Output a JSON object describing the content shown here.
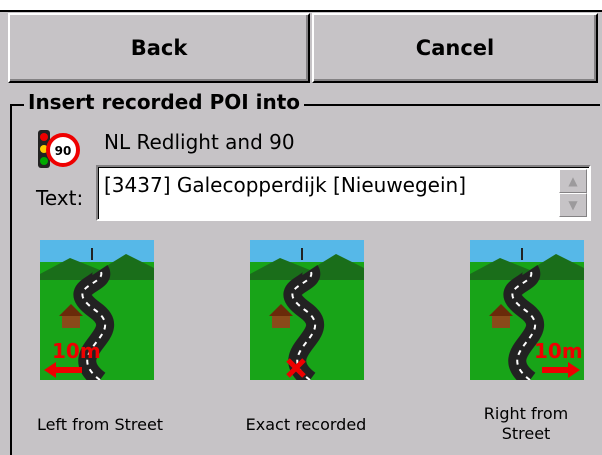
{
  "toolbar": {
    "back_label": "Back",
    "cancel_label": "Cancel"
  },
  "group": {
    "title": "Insert recorded POI into"
  },
  "poi": {
    "name": "NL Redlight and 90",
    "speed": "90"
  },
  "text_field": {
    "label": "Text:",
    "value": "[3437] Galecopperdijk [Nieuwegein]"
  },
  "options": [
    {
      "label": "Left from Street",
      "distance": "10m"
    },
    {
      "label": "Exact recorded"
    },
    {
      "label": "Right from Street",
      "distance": "10m"
    }
  ]
}
